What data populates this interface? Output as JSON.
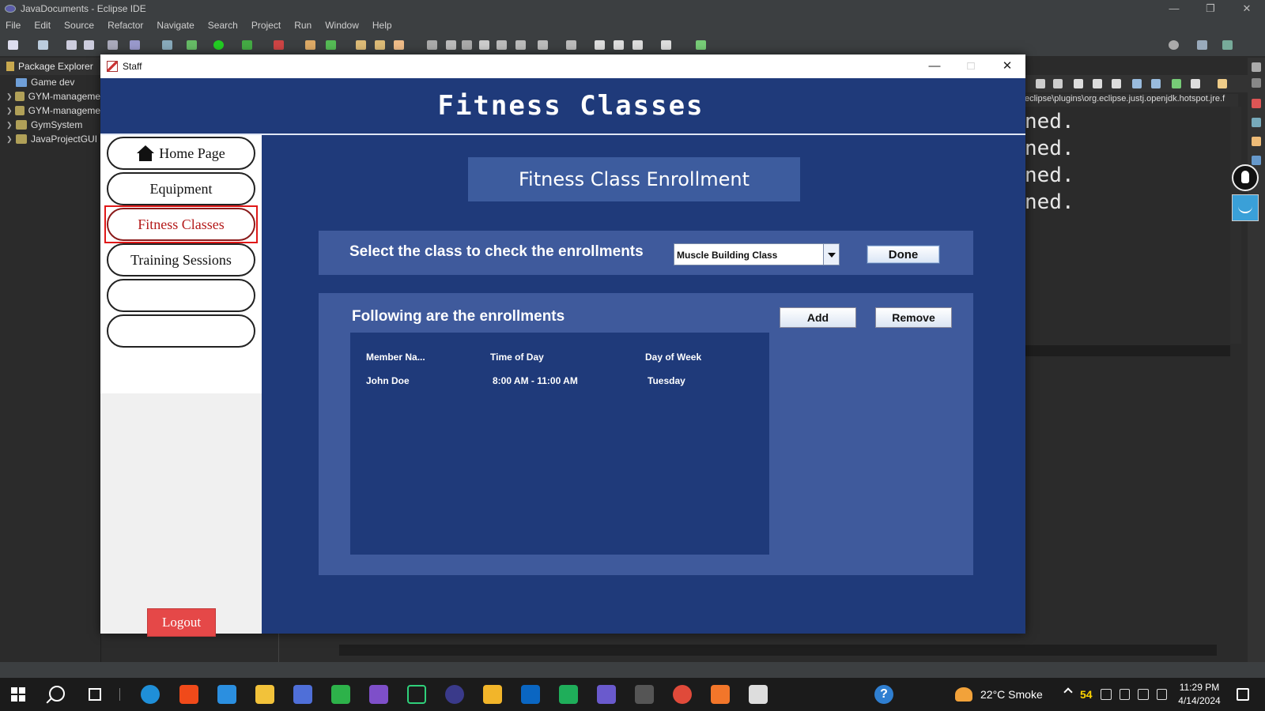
{
  "eclipse": {
    "window_title": "JavaDocuments - Eclipse IDE",
    "menu": [
      "File",
      "Edit",
      "Source",
      "Refactor",
      "Navigate",
      "Search",
      "Project",
      "Run",
      "Window",
      "Help"
    ],
    "package_explorer": {
      "title": "Package Explorer",
      "items": [
        "Game dev",
        "GYM-manageme",
        "GYM-manageme",
        "GymSystem",
        "JavaProjectGUI"
      ]
    },
    "console_path": "eclipse\\plugins\\org.eclipse.justj.openjdk.hotspot.jre.f",
    "console_lines": [
      "ned.",
      "ned.",
      "ned.",
      "ned."
    ]
  },
  "staff_window": {
    "title": "Staff",
    "header_title": "Fitness Classes",
    "nav": {
      "home": "Home Page",
      "equipment": "Equipment",
      "fitness_classes": "Fitness Classes",
      "training_sessions": "Training Sessions",
      "empty_1": "",
      "empty_2": ""
    },
    "logout_label": "Logout",
    "enrollment_title": "Fitness Class Enrollment",
    "select_label": "Select the class to check the enrollments",
    "selected_class": "Muscle Building Class",
    "done_label": "Done",
    "enrollments_label": "Following are the enrollments",
    "add_label": "Add",
    "remove_label": "Remove",
    "table": {
      "columns": [
        "Member Na...",
        "Time of Day",
        "Day of Week"
      ],
      "rows": [
        [
          "John Doe",
          "8:00 AM - 11:00 AM",
          "Tuesday"
        ]
      ]
    }
  },
  "taskbar": {
    "weather": "22°C  Smoke",
    "notification_count": "54",
    "time": "11:29 PM",
    "date": "4/14/2024"
  },
  "colors": {
    "header_bg": "#1f3a7a",
    "panel_bg": "#3f5a9c",
    "active_nav": "#b41a1a",
    "logout_bg": "#e54848"
  }
}
